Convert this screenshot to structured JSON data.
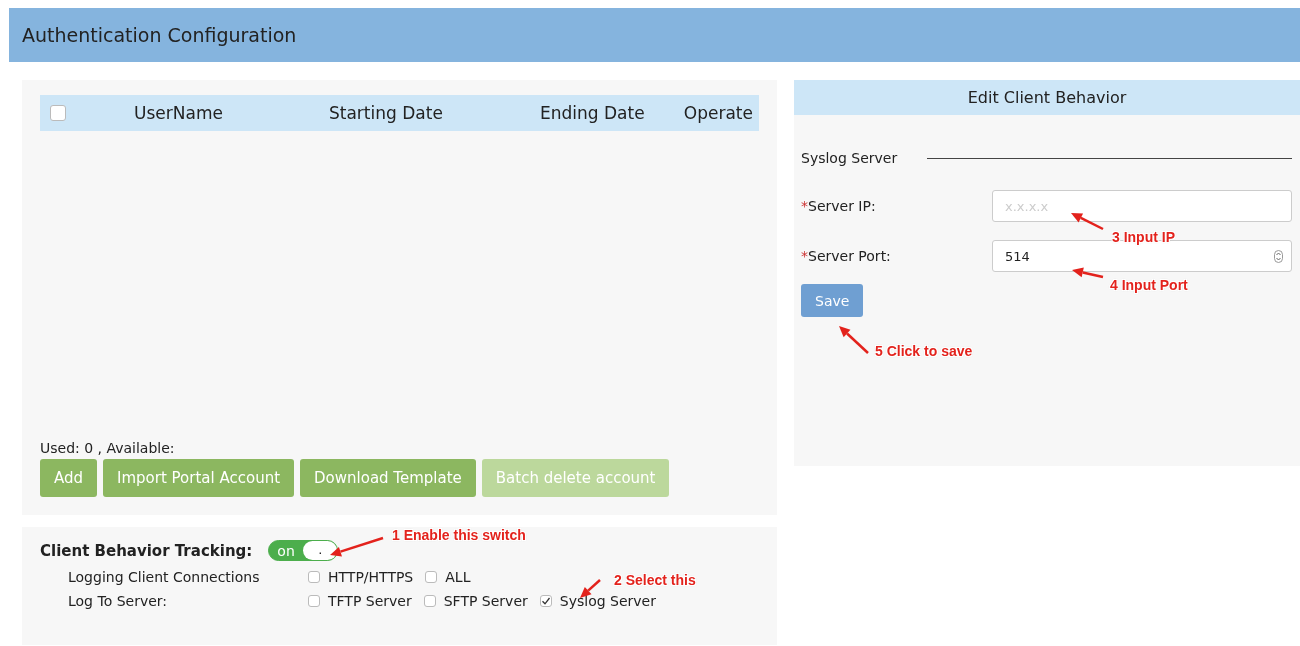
{
  "header": {
    "title": "Authentication Configuration"
  },
  "accounts": {
    "select_all_checked": false,
    "columns": [
      "UserName",
      "Starting Date",
      "Ending Date",
      "Operate"
    ],
    "usage": "Used: 0 , Available:",
    "buttons": [
      {
        "label": "Add",
        "disabled": false
      },
      {
        "label": "Import Portal Account",
        "disabled": false
      },
      {
        "label": "Download Template",
        "disabled": false
      },
      {
        "label": "Batch delete account",
        "disabled": true
      }
    ]
  },
  "tracking": {
    "label": "Client Behavior Tracking:",
    "switch": {
      "on": true,
      "on_text": "on",
      "knob_text": "."
    },
    "rows": [
      {
        "label": "Logging Client Connections",
        "options": [
          {
            "label": "HTTP/HTTPS",
            "checked": false
          },
          {
            "label": "ALL",
            "checked": false
          }
        ]
      },
      {
        "label": "Log To Server:",
        "options": [
          {
            "label": "TFTP Server",
            "checked": false
          },
          {
            "label": "SFTP Server",
            "checked": false
          },
          {
            "label": "Syslog Server",
            "checked": true
          }
        ]
      }
    ]
  },
  "edit_panel": {
    "title": "Edit Client Behavior",
    "section": "Syslog Server",
    "fields": [
      {
        "required_mark": "*",
        "label": "Server IP:",
        "placeholder": "x.x.x.x",
        "kind": "text"
      },
      {
        "required_mark": "*",
        "label": "Server Port:",
        "value": "514",
        "kind": "number"
      }
    ],
    "save_button": "Save"
  },
  "annotations": [
    {
      "text": "1 Enable this switch"
    },
    {
      "text": "2 Select this"
    },
    {
      "text": "3 Input IP"
    },
    {
      "text": "4 Input Port"
    },
    {
      "text": "5 Click to save"
    }
  ]
}
